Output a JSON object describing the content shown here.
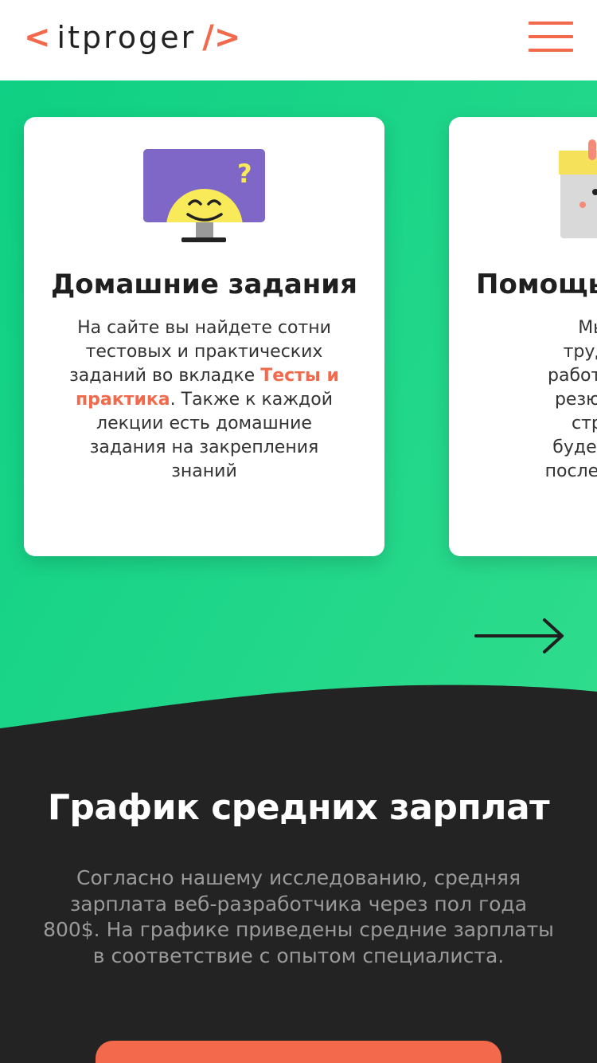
{
  "header": {
    "logo_left_bracket": "<",
    "logo_text": "itproger",
    "logo_right_bracket": "/>",
    "menu_icon": "hamburger-menu-icon",
    "accent_color": "#f26a4b"
  },
  "cards": [
    {
      "icon": "monitor-smiley-question-icon",
      "title": "Домашние задания",
      "text_before_link": "На сайте вы найдете сотни тестовых и практических заданий во вкладке ",
      "link_text": "Тесты и практика",
      "text_after_link": ". Также к каждой лекции есть домашние задания на закрепления знаний"
    },
    {
      "icon": "calendar-icon",
      "title": "Помощь",
      "lines": [
        "Мы пом",
        "трудоуст",
        "работу. Вм",
        "резюме, д",
        "страниц",
        "будем сод",
        "после прох"
      ]
    }
  ],
  "carousel": {
    "next_icon": "arrow-right-icon"
  },
  "salary_section": {
    "title": "График средних зарплат",
    "text": "Согласно нашему исследованию, средняя зарплата веб-разработчика через пол года 800$. На графике приведены средние зарплаты в соответствие с опытом специалиста."
  },
  "colors": {
    "green": "#1fd689",
    "dark": "#232323",
    "accent": "#f26a4b"
  }
}
